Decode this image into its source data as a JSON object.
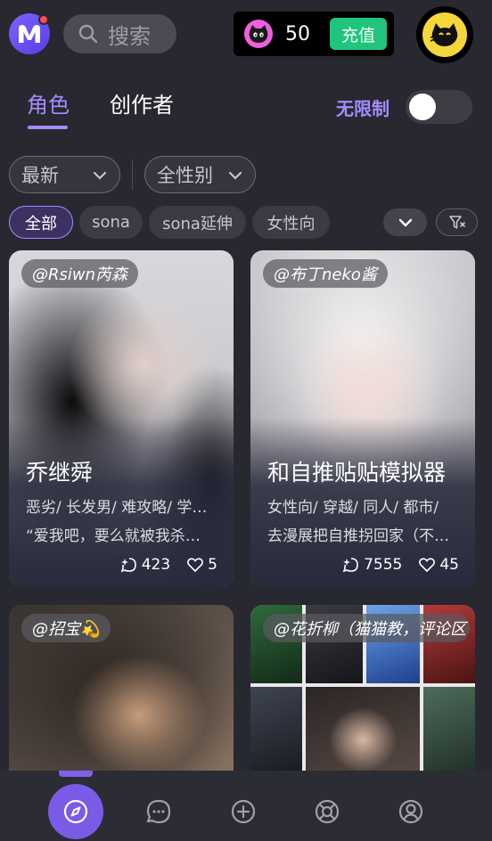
{
  "header": {
    "search_placeholder": "搜索",
    "coin_count": "50",
    "recharge_label": "充值",
    "icons": [
      "app-logo-icon",
      "search-icon",
      "cat-coin-icon",
      "cat-avatar-icon"
    ]
  },
  "tabs": {
    "roles": "角色",
    "creators": "创作者",
    "active": "roles"
  },
  "unlimited": {
    "label": "无限制",
    "enabled": false
  },
  "filters": {
    "sort": "最新",
    "gender": "全性别",
    "chips": [
      "全部",
      "sona",
      "sona延伸",
      "女性向"
    ],
    "active_chip": "全部"
  },
  "cards": [
    {
      "author": "@Rsiwn芮森",
      "title": "乔继舜",
      "tags": "恶劣/ 长发男/ 难攻略/ 学生 /",
      "quote": "“爱我吧，要么就被我杀死。”",
      "chats": "423",
      "likes": "5"
    },
    {
      "author": "@布丁neko酱",
      "title": "和自推贴贴模拟器",
      "tags": "女性向/ 穿越/ 同人/ 都市/",
      "quote": "去漫展把自推拐回家（不是）",
      "chats": "7555",
      "likes": "45"
    },
    {
      "author": "@招宝💫"
    },
    {
      "author": "@花折柳（猫猫教，评论区"
    }
  ],
  "colors": {
    "background": "#272830",
    "accent": "#a58bff",
    "recharge": "#20c57b",
    "coin": "#ee5fe0"
  },
  "bottom_nav": [
    "compass-icon",
    "chat-bubble-icon",
    "plus-circle-icon",
    "lifebuoy-icon",
    "user-icon"
  ]
}
